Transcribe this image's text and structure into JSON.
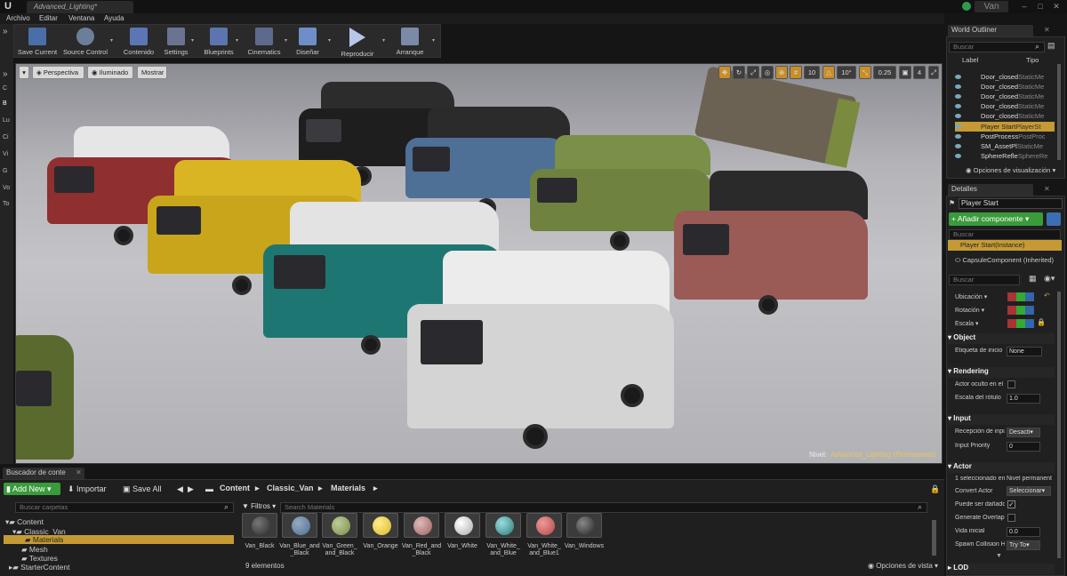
{
  "titlebar": {
    "doc_tab": "Advanced_Lighting*",
    "project": "Van"
  },
  "menu": [
    "Archivo",
    "Editar",
    "Ventana",
    "Ayuda"
  ],
  "left_strip": [
    "C",
    "B",
    "Lu",
    "Ci",
    "Vi",
    "G",
    "Vo",
    "To"
  ],
  "toolbar": {
    "save_current": "Save Current",
    "source_control": "Source Control",
    "contenido": "Contenido",
    "settings": "Settings",
    "blueprints": "Blueprints",
    "cinematics": "Cinematics",
    "disenar": "Diseñar",
    "reproducir": "Reproducir",
    "arranque": "Arranque"
  },
  "viewport": {
    "perspective": "Perspectiva",
    "lit": "Iluminado",
    "show": "Mostrar",
    "grid_snap": "10",
    "rot_snap": "10°",
    "scale_snap": "0.25",
    "camera_speed": "4",
    "level_label": "Nivel:",
    "level_name": "Advanced_Lighting (Permanente)"
  },
  "outliner": {
    "tab": "World Outliner",
    "search_placeholder": "Buscar",
    "col_label": "Label",
    "col_type": "Tipo",
    "rows": [
      {
        "label": "Door_closed",
        "type": "StaticMe"
      },
      {
        "label": "Door_closed",
        "type": "StaticMe"
      },
      {
        "label": "Door_closed",
        "type": "StaticMe"
      },
      {
        "label": "Door_closed",
        "type": "StaticMe"
      },
      {
        "label": "Door_closed",
        "type": "StaticMe"
      },
      {
        "label": "Player Start",
        "type": "PlayerSt"
      },
      {
        "label": "PostProcess",
        "type": "PostProc"
      },
      {
        "label": "SM_AssetPl",
        "type": "StaticMe"
      },
      {
        "label": "SphereRefle",
        "type": "SphereRe"
      }
    ],
    "view_options": "Opciones de visualización"
  },
  "details": {
    "tab": "Detalles",
    "name": "Player Start",
    "add_component": "+ Añadir componente",
    "search_placeholder": "Buscar",
    "instance": "Player Start(Instance)",
    "component": "CapsuleComponent (Inherited)",
    "search2_placeholder": "Buscar",
    "transform": {
      "location": "Ubicación",
      "rotation": "Rotación",
      "scale": "Escala"
    },
    "object_cat": "Object",
    "tag_label": "Etiqueta de inicio",
    "tag_value": "None",
    "rendering_cat": "Rendering",
    "hidden_label": "Actor oculto en el",
    "billboard_label": "Escala del rótulo",
    "billboard_value": "1.0",
    "input_cat": "Input",
    "autoreceive_label": "Recepción de inpu",
    "autoreceive_value": "Desacti",
    "priority_label": "Input Priority",
    "priority_value": "0",
    "actor_cat": "Actor",
    "selected_label": "1 seleccionado en",
    "selected_value": "Nivel permanent",
    "convert_label": "Convert Actor",
    "convert_value": "Seleccionar",
    "damage_label": "Puede ser dañado",
    "overlap_label": "Generate Overlap",
    "lifespan_label": "Vida inicial",
    "lifespan_value": "0.0",
    "spawn_label": "Spawn Collision H",
    "spawn_value": "Try To",
    "lod_cat": "LOD"
  },
  "content_browser": {
    "tab": "Buscador de conte",
    "add_new": "Add New",
    "import": "Importar",
    "save_all": "Save All",
    "breadcrumbs": [
      "Content",
      "Classic_Van",
      "Materials"
    ],
    "folder_search": "Buscar carpetas",
    "filters": "Filtros",
    "asset_search": "Search Materials",
    "tree": [
      {
        "label": "Content",
        "level": 0
      },
      {
        "label": "Classic_Van",
        "level": 1
      },
      {
        "label": "Materials",
        "level": 2
      },
      {
        "label": "Mesh",
        "level": 2
      },
      {
        "label": "Textures",
        "level": 2
      },
      {
        "label": "StarterContent",
        "level": 1
      }
    ],
    "assets": [
      {
        "label": "Van_Black",
        "color": "#2a2a2a"
      },
      {
        "label": "Van_Blue_and _Black",
        "color": "#4a6f9a"
      },
      {
        "label": "Van_Green_ and_Black",
        "color": "#7b8e48"
      },
      {
        "label": "Van_Orange",
        "color": "#d7b82c"
      },
      {
        "label": "Van_Red_and _Black",
        "color": "#a06060"
      },
      {
        "label": "Van_White",
        "color": "#d8d8d8"
      },
      {
        "label": "Van_White_ and_Blue",
        "color": "#4d9a98"
      },
      {
        "label": "Van_White_ and_Blue1",
        "color": "#b34848"
      },
      {
        "label": "Van_Windows",
        "color": "#383838"
      }
    ],
    "count": "9 elementos",
    "view_options": "Opciones de vista"
  },
  "colors": {
    "accent_green": "#3a9b3a",
    "selection": "#c59a34",
    "level_name": "#e8c65a"
  }
}
